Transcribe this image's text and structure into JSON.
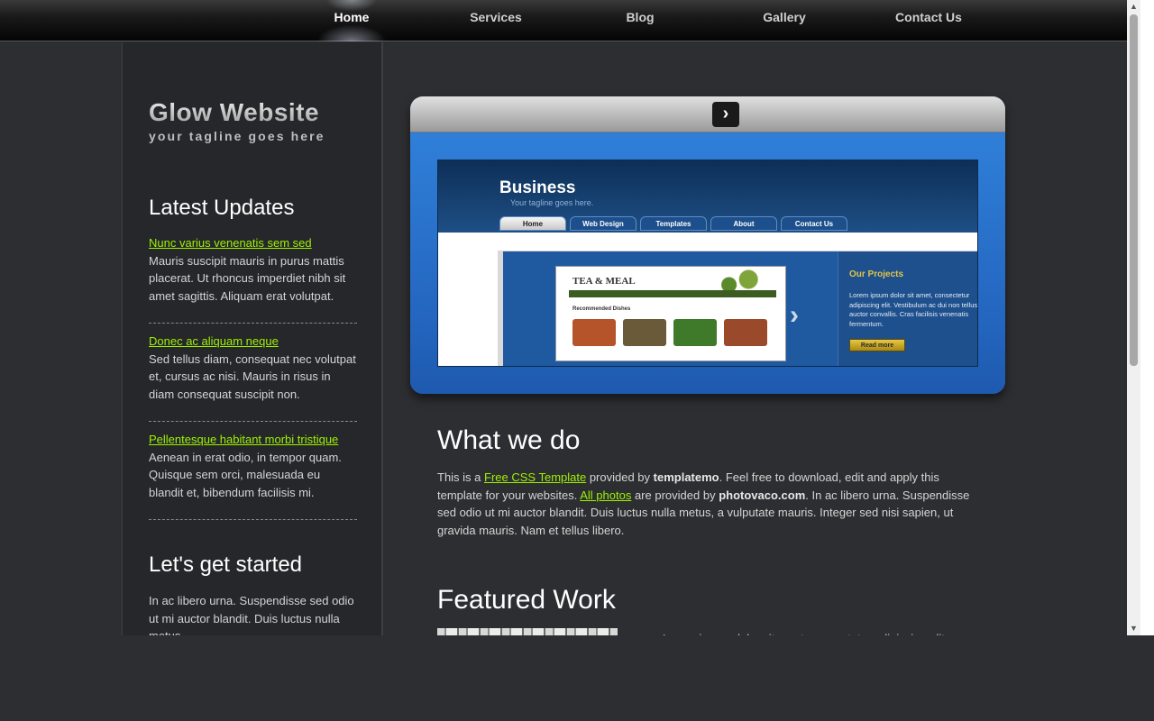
{
  "nav": {
    "items": [
      "Home",
      "Services",
      "Blog",
      "Gallery",
      "Contact Us"
    ],
    "active": "Home"
  },
  "site": {
    "title": "Glow Website",
    "tagline": "your tagline goes here"
  },
  "sidebar": {
    "latest_heading": "Latest Updates",
    "updates": [
      {
        "title": "Nunc varius venenatis sem sed",
        "text": "Mauris suscipit mauris in purus mattis placerat. Ut rhoncus imperdiet nibh sit amet sagittis. Aliquam erat volutpat."
      },
      {
        "title": "Donec ac aliquam neque",
        "text": "Sed tellus diam, consequat nec volutpat et, cursus ac nisi. Mauris in risus in diam consequat suscipit non."
      },
      {
        "title": "Pellentesque habitant morbi tristique",
        "text": "Aenean in erat odio, in tempor quam. Quisque sem orci, malesuada eu blandit et, bibendum facilisis mi."
      }
    ],
    "started_heading": "Let's get started",
    "started_text": "In ac libero urna. Suspendisse sed odio ut mi auctor blandit. Duis luctus nulla metus"
  },
  "slider": {
    "next_icon": "chevron-right-icon",
    "preview": {
      "title": "Business",
      "tagline": "Your tagline goes here.",
      "tabs": [
        "Home",
        "Web Design",
        "Templates",
        "About",
        "Contact Us"
      ],
      "mini_logo": "TEA & MEAL",
      "mini_heading": "Recommended Dishes",
      "side_heading": "Our Projects",
      "side_text": "Lorem ipsum dolor sit amet, consectetur adipiscing elit. Vestibulum ac dui non tellus auctor convallis. Cras facilisis venenatis fermentum.",
      "side_button": "Read more"
    }
  },
  "content": {
    "what_heading": "What we do",
    "what_p1": "This is a ",
    "what_link1": "Free CSS Template",
    "what_p2": " provided by ",
    "what_b1": "templatemo",
    "what_p3": ". Feel free to download, edit and apply this template for your websites. ",
    "what_link2": "All photos",
    "what_p4": " are provided by ",
    "what_b2": "photovaco.com",
    "what_p5": ". In ac libero urna. Suspendisse sed odio ut mi auctor blandit. Duis luctus nulla metus, a vulputate mauris. Integer sed nisi sapien, ut gravida mauris. Nam et tellus libero.",
    "featured_heading": "Featured Work",
    "featured_text": "Lorem ipsum dolor sit amet, consectetur adipiscing elit."
  },
  "colors": {
    "link": "#9cf200",
    "background": "#2d2e31",
    "sidebar": "#26272b",
    "slider_blue": "#2d7bd6"
  }
}
